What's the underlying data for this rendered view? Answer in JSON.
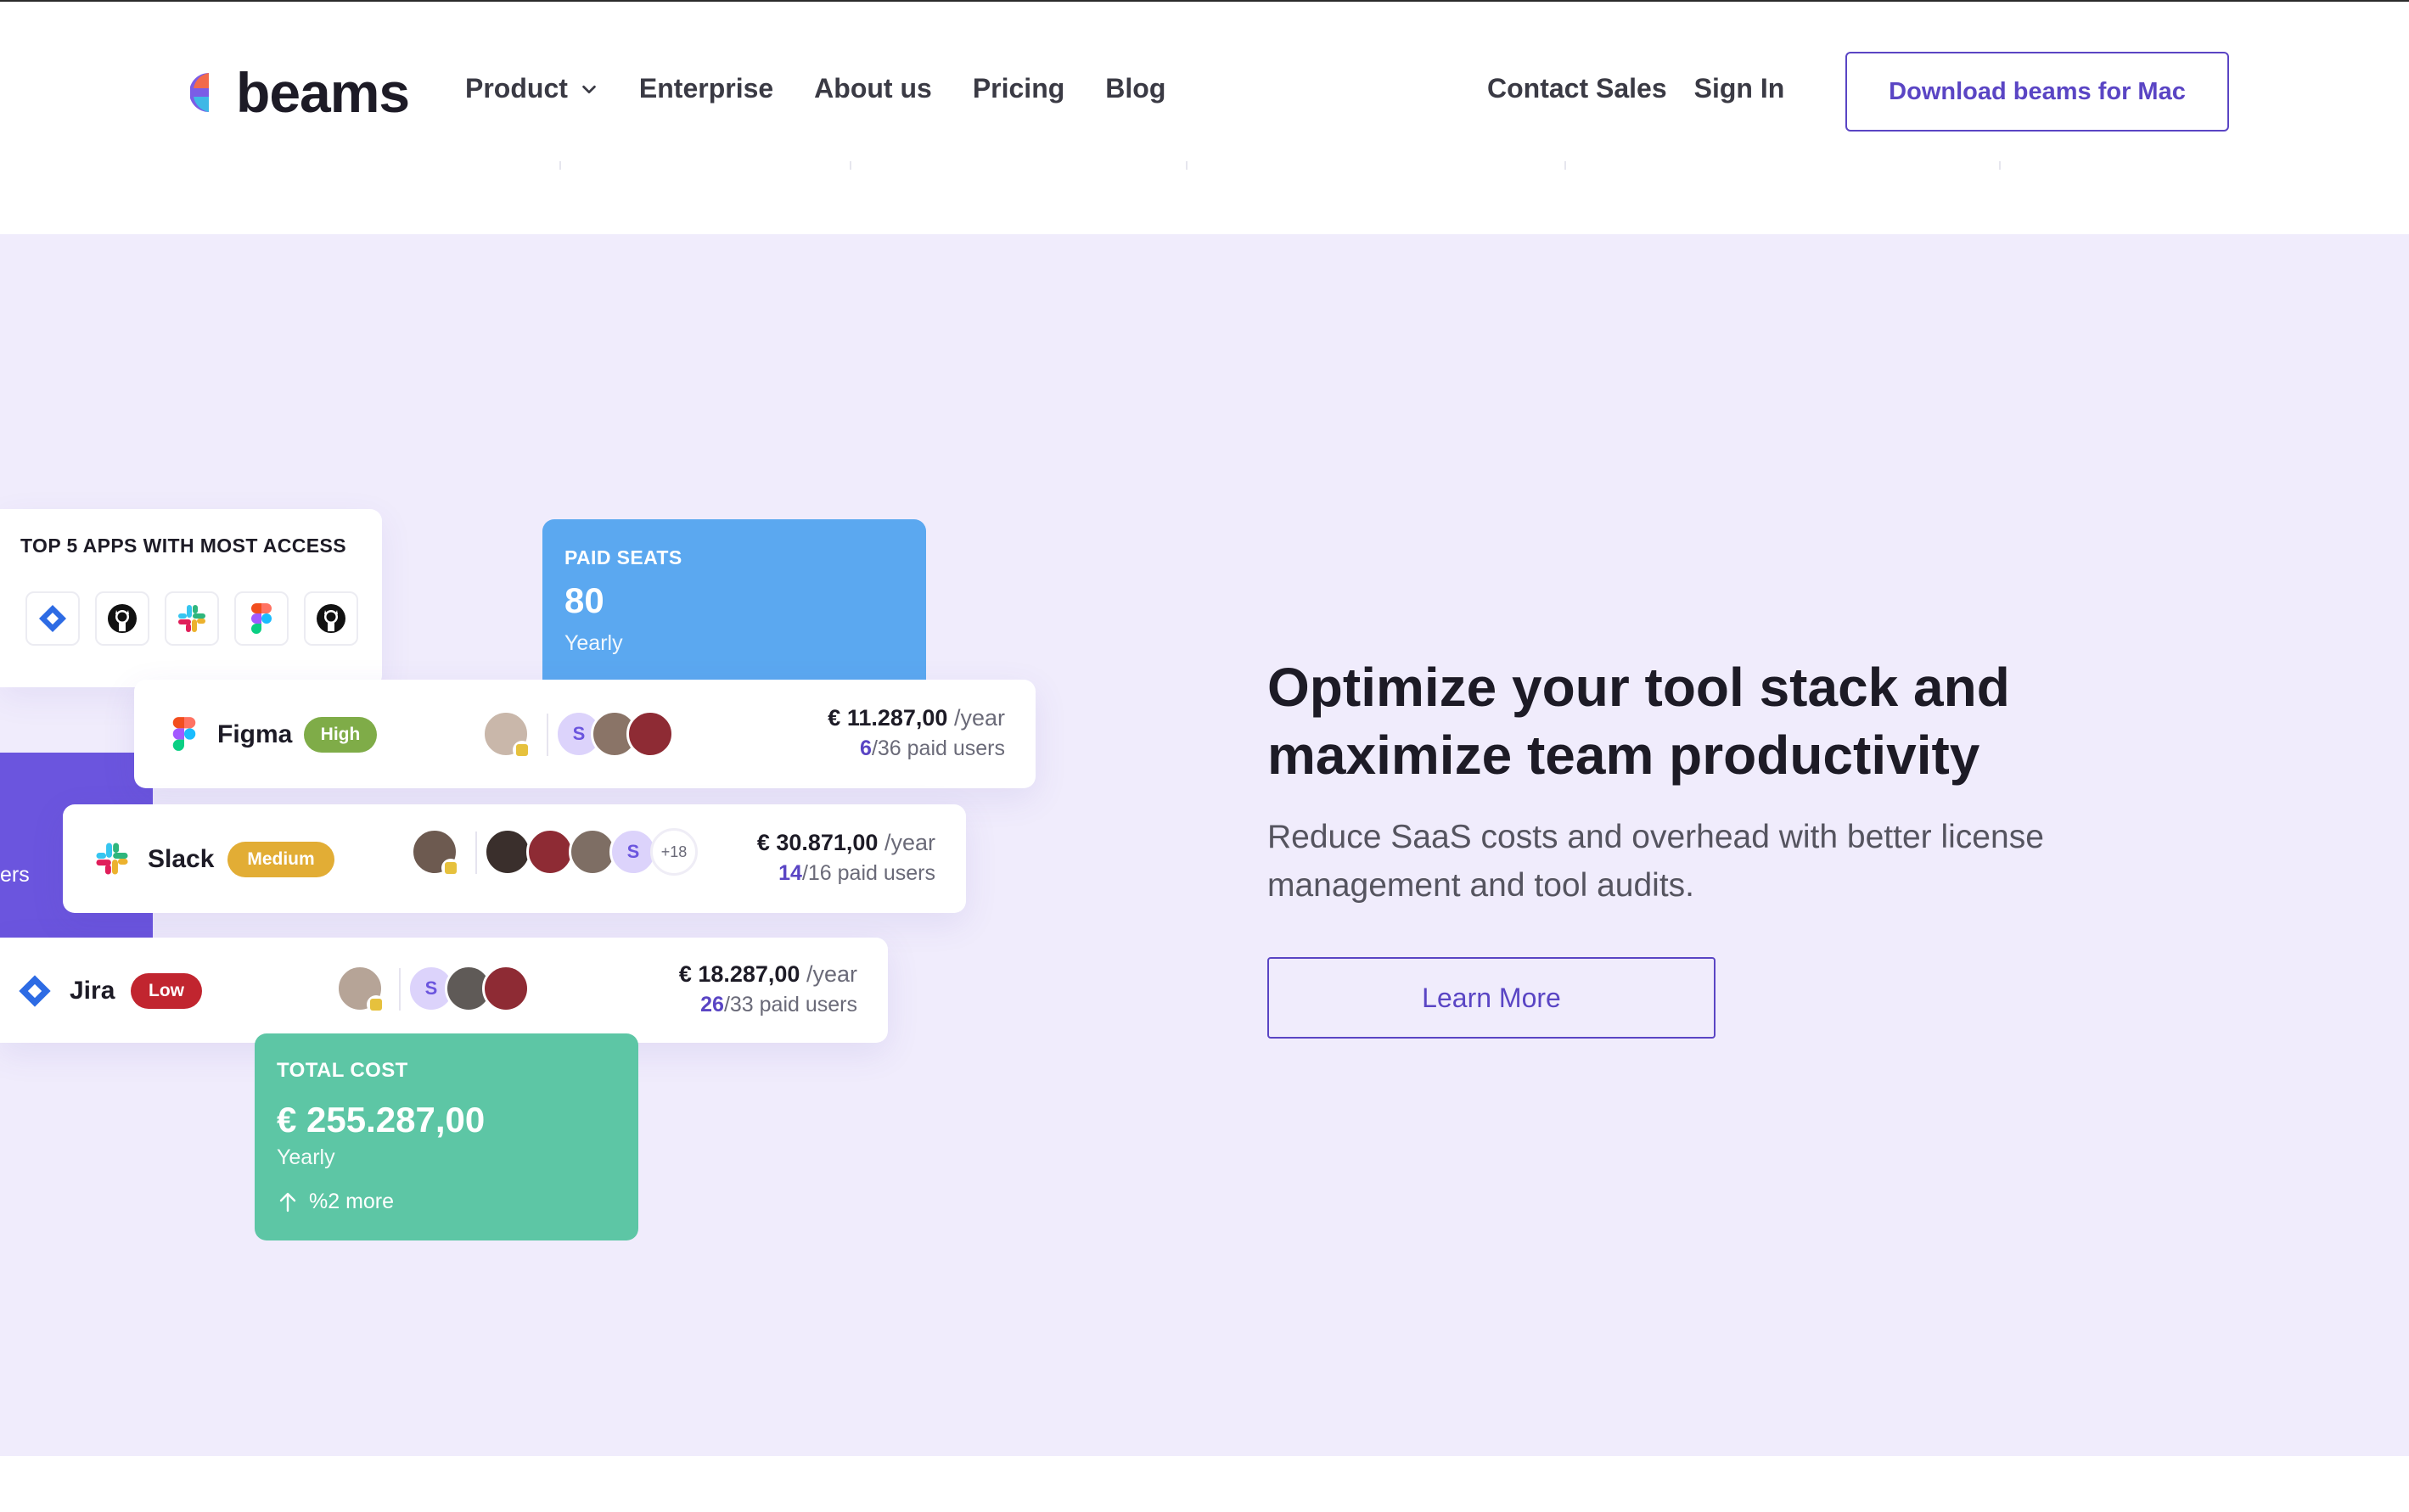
{
  "brand": {
    "name": "beams",
    "colors": {
      "accent": "#5a45c4",
      "hero_bg": "#f0ecfc",
      "blue_card": "#5ba8f0",
      "green_card": "#5dc6a5"
    }
  },
  "nav": {
    "items": [
      {
        "label": "Product",
        "has_dropdown": true,
        "icon": "chevron-down-icon"
      },
      {
        "label": "Enterprise"
      },
      {
        "label": "About us"
      },
      {
        "label": "Pricing"
      },
      {
        "label": "Blog"
      }
    ],
    "right": {
      "contact": "Contact Sales",
      "signin": "Sign In"
    },
    "cta": "Download beams for Mac"
  },
  "dashboard": {
    "top5": {
      "title": "TOP 5 APPS WITH MOST ACCESS",
      "apps": [
        "jira-icon",
        "github-icon",
        "slack-icon",
        "figma-icon",
        "github-icon"
      ]
    },
    "paid_seats": {
      "label": "PAID SEATS",
      "value": "80",
      "period": "Yearly"
    },
    "side_card_fragment": "ers",
    "apps": [
      {
        "name": "Figma",
        "priority": "High",
        "price": "€ 11.287,00",
        "per": "/year",
        "used": "6",
        "total_seats": "/36 paid users"
      },
      {
        "name": "Slack",
        "priority": "Medium",
        "price": "€ 30.871,00",
        "per": "/year",
        "used": "14",
        "total_seats": "/16 paid users",
        "more_users": "+18"
      },
      {
        "name": "Jira",
        "priority": "Low",
        "price": "€ 18.287,00",
        "per": "/year",
        "used": "26",
        "total_seats": "/33 paid users"
      }
    ],
    "avatar_initial": "S",
    "total_cost": {
      "label": "TOTAL COST",
      "value": "€ 255.287,00",
      "period": "Yearly",
      "trend": "%2 more",
      "trend_icon": "arrow-up-icon"
    }
  },
  "hero": {
    "headline_1": "Optimize your tool stack and",
    "headline_2": "maximize team productivity",
    "subtext_1": "Reduce SaaS costs and overhead with better license",
    "subtext_2": "management and tool audits.",
    "cta": "Learn More"
  }
}
